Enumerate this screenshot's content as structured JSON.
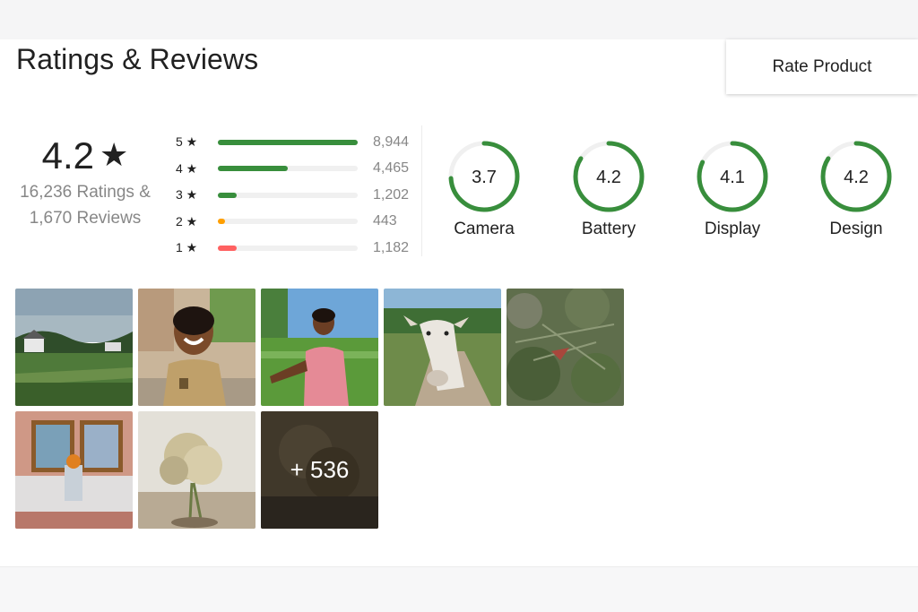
{
  "header": {
    "title": "Ratings & Reviews",
    "rate_button": "Rate Product"
  },
  "overall": {
    "value": "4.2",
    "star": "★",
    "ratings_text": "16,236 Ratings &",
    "reviews_text": "1,670 Reviews"
  },
  "distribution": [
    {
      "label": "5 ★",
      "count": "8,944",
      "fraction": 1.0,
      "color": "#388e3c"
    },
    {
      "label": "4 ★",
      "count": "4,465",
      "fraction": 0.5,
      "color": "#388e3c"
    },
    {
      "label": "3 ★",
      "count": "1,202",
      "fraction": 0.135,
      "color": "#388e3c"
    },
    {
      "label": "2 ★",
      "count": "443",
      "fraction": 0.05,
      "color": "#ff9f00"
    },
    {
      "label": "1 ★",
      "count": "1,182",
      "fraction": 0.132,
      "color": "#ff6161"
    }
  ],
  "aspects": [
    {
      "score": "3.7",
      "label": "Camera",
      "fraction": 0.74
    },
    {
      "score": "4.2",
      "label": "Battery",
      "fraction": 0.84
    },
    {
      "score": "4.1",
      "label": "Display",
      "fraction": 0.82
    },
    {
      "score": "4.2",
      "label": "Design",
      "fraction": 0.84
    }
  ],
  "gallery": {
    "more_label": "+ 536",
    "photos": [
      {
        "name": "photo-landscape-house"
      },
      {
        "name": "photo-smiling-child"
      },
      {
        "name": "photo-boy-field"
      },
      {
        "name": "photo-cow"
      },
      {
        "name": "photo-plants-closeup"
      },
      {
        "name": "photo-shrine-frames"
      },
      {
        "name": "photo-dried-flowers"
      }
    ]
  },
  "colors": {
    "accent_green": "#388e3c",
    "star_orange": "#ff9f00",
    "star_red": "#ff6161",
    "muted_text": "#878787"
  }
}
